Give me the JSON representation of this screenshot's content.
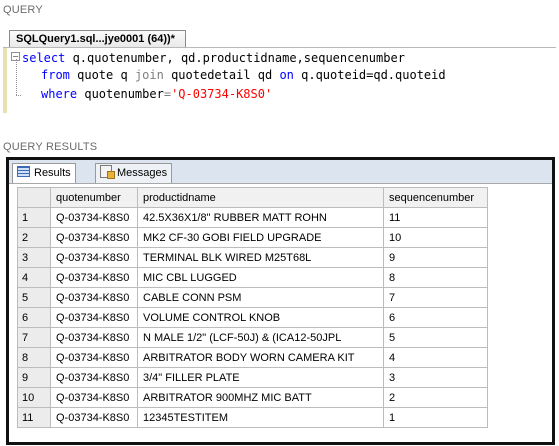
{
  "query_section": {
    "title": "QUERY",
    "tab_label": "SQLQuery1.sql...jye0001 (64))*",
    "code": {
      "line1": {
        "kw_select": "select",
        "rest": " q.quotenumber, qd.productidname,sequencenumber"
      },
      "line2": {
        "kw_from": "from",
        "mid1": " quote q ",
        "kw_join": "join",
        "mid2": " quotedetail qd ",
        "kw_on": "on",
        "rest": " q.quoteid=qd.quoteid"
      },
      "line3": {
        "kw_where": "where",
        "mid": " quotenumber",
        "eq": "=",
        "str": "'Q-03734-K8S0'"
      }
    }
  },
  "results_section": {
    "title": "QUERY RESULTS",
    "tabs": [
      "Results",
      "Messages"
    ],
    "columns": [
      "quotenumber",
      "productidname",
      "sequencenumber"
    ],
    "rows": [
      [
        "1",
        "Q-03734-K8S0",
        "42.5X36X1/8\" RUBBER MATT ROHN",
        "11"
      ],
      [
        "2",
        "Q-03734-K8S0",
        "MK2 CF-30 GOBI FIELD UPGRADE",
        "10"
      ],
      [
        "3",
        "Q-03734-K8S0",
        "TERMINAL BLK WIRED M25T68L",
        "9"
      ],
      [
        "4",
        "Q-03734-K8S0",
        "MIC CBL LUGGED",
        "8"
      ],
      [
        "5",
        "Q-03734-K8S0",
        "CABLE CONN PSM",
        "7"
      ],
      [
        "6",
        "Q-03734-K8S0",
        "VOLUME CONTROL KNOB",
        "6"
      ],
      [
        "7",
        "Q-03734-K8S0",
        "N MALE 1/2\" (LCF-50J) & (ICA12-50JPL",
        "5"
      ],
      [
        "8",
        "Q-03734-K8S0",
        "ARBITRATOR BODY WORN CAMERA KIT",
        "4"
      ],
      [
        "9",
        "Q-03734-K8S0",
        "3/4\" FILLER PLATE",
        "3"
      ],
      [
        "10",
        "Q-03734-K8S0",
        "ARBITRATOR 900MHZ MIC BATT",
        "2"
      ],
      [
        "11",
        "Q-03734-K8S0",
        "12345TESTITEM",
        "1"
      ]
    ]
  }
}
